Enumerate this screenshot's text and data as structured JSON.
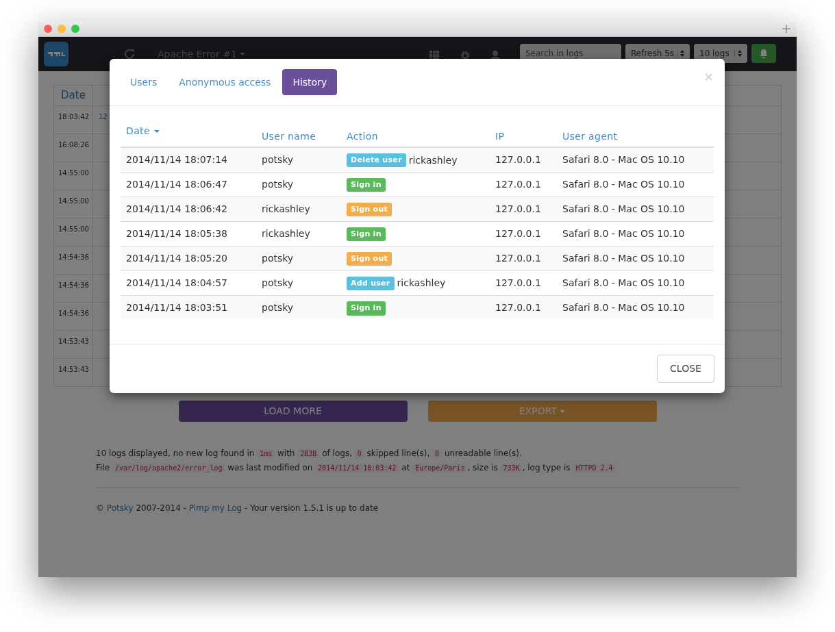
{
  "navbar": {
    "log_selector": "Apache Error #1",
    "search": {
      "placeholder": "Search in logs"
    },
    "refresh": "Refresh 5s",
    "count": "10 logs"
  },
  "log_table": {
    "columns": [
      "Date"
    ],
    "rows": [
      {
        "date": "18:03:42",
        "column_2": "12"
      },
      {
        "date": "16:08:26"
      },
      {
        "date": "14:55:00"
      },
      {
        "date": "14:55:00"
      },
      {
        "date": "14:55:00"
      },
      {
        "date": "14:54:36"
      },
      {
        "date": "14:54:36"
      },
      {
        "date": "14:54:36"
      },
      {
        "date": "14:53:43"
      },
      {
        "date": "14:53:43"
      }
    ]
  },
  "buttons": [
    {
      "label": "LOAD MORE",
      "kind": "load"
    },
    {
      "label": "EXPORT",
      "kind": "export"
    }
  ],
  "info_lines": [
    [
      {
        "text": "10 logs displayed, no new log found in "
      },
      {
        "text": "1ms",
        "code": true
      },
      {
        "text": " with "
      },
      {
        "text": "283B",
        "code": true
      },
      {
        "text": " of logs, "
      },
      {
        "text": "0",
        "code": true
      },
      {
        "text": " skipped line(s), "
      },
      {
        "text": "0",
        "code": true
      },
      {
        "text": " unreadable line(s)."
      }
    ],
    [
      {
        "text": "File "
      },
      {
        "text": "/var/log/apache2/error_log",
        "code": true
      },
      {
        "text": " was last modified on "
      },
      {
        "text": "2014/11/14 18:03:42",
        "code": true
      },
      {
        "text": " at "
      },
      {
        "text": "Europe/Paris",
        "code": true
      },
      {
        "text": ", size is "
      },
      {
        "text": "733K",
        "code": true
      },
      {
        "text": ", log type is "
      },
      {
        "text": "HTTPD 2.4",
        "code": true
      }
    ]
  ],
  "footer": [
    {
      "text": "© "
    },
    {
      "text": "Potsky",
      "link": true
    },
    {
      "text": " 2007-2014 - "
    },
    {
      "text": "Pimp my Log",
      "link": true
    },
    {
      "text": " - Your version 1.5.1 is up to date"
    }
  ],
  "modal": {
    "tabs": [
      {
        "label": "Users",
        "selected": false
      },
      {
        "label": "Anonymous access",
        "selected": false
      },
      {
        "label": "History",
        "selected": true
      }
    ],
    "close_icon": "×",
    "columns": [
      "Date",
      "User name",
      "Action",
      "IP",
      "User agent"
    ],
    "rows": [
      {
        "date": "2014/11/14 18:07:14",
        "user": "potsky",
        "action": {
          "label": "Delete user",
          "color": "#5bc0de"
        },
        "target": "rickashley",
        "ip": "127.0.0.1",
        "agent": "Safari 8.0 - Mac OS 10.10"
      },
      {
        "date": "2014/11/14 18:06:47",
        "user": "potsky",
        "action": {
          "label": "Sign in",
          "color": "#5cb85c"
        },
        "ip": "127.0.0.1",
        "agent": "Safari 8.0 - Mac OS 10.10"
      },
      {
        "date": "2014/11/14 18:06:42",
        "user": "rickashley",
        "action": {
          "label": "Sign out",
          "color": "#f0ad4e"
        },
        "ip": "127.0.0.1",
        "agent": "Safari 8.0 - Mac OS 10.10"
      },
      {
        "date": "2014/11/14 18:05:38",
        "user": "rickashley",
        "action": {
          "label": "Sign in",
          "color": "#5cb85c"
        },
        "ip": "127.0.0.1",
        "agent": "Safari 8.0 - Mac OS 10.10"
      },
      {
        "date": "2014/11/14 18:05:20",
        "user": "potsky",
        "action": {
          "label": "Sign out",
          "color": "#f0ad4e"
        },
        "ip": "127.0.0.1",
        "agent": "Safari 8.0 - Mac OS 10.10"
      },
      {
        "date": "2014/11/14 18:04:57",
        "user": "potsky",
        "action": {
          "label": "Add user",
          "color": "#5bc0de"
        },
        "target": "rickashley",
        "ip": "127.0.0.1",
        "agent": "Safari 8.0 - Mac OS 10.10"
      },
      {
        "date": "2014/11/14 18:03:51",
        "user": "potsky",
        "action": {
          "label": "Sign in",
          "color": "#5cb85c"
        },
        "ip": "127.0.0.1",
        "agent": "Safari 8.0 - Mac OS 10.10"
      }
    ],
    "close_button": "CLOSE"
  }
}
